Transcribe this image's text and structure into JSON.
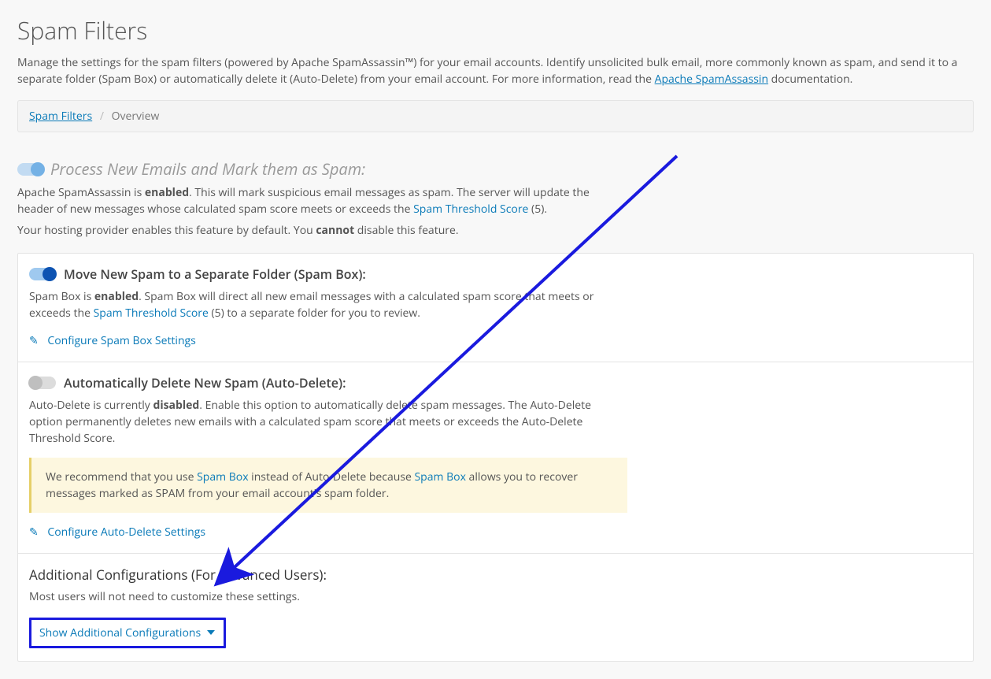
{
  "title": "Spam Filters",
  "intro_before_link": "Manage the settings for the spam filters (powered by Apache SpamAssassin™) for your email accounts. Identify unsolicited bulk email, more commonly known as spam, and send it to a separate folder (Spam Box) or automatically delete it (Auto-Delete) from your email account. For more information, read the ",
  "intro_link": "Apache SpamAssassin",
  "intro_after_link": " documentation.",
  "breadcrumb": {
    "root": "Spam Filters",
    "current": "Overview"
  },
  "process": {
    "heading": "Process New Emails and Mark them as Spam:",
    "desc_a": "Apache SpamAssassin is ",
    "desc_b_strong": "enabled",
    "desc_c": ". This will mark suspicious email messages as spam. The server will update the header of new messages whose calculated spam score meets or exceeds the ",
    "desc_link": "Spam Threshold Score",
    "desc_d": " (5).",
    "note_a": "Your hosting provider enables this feature by default. You ",
    "note_strong": "cannot",
    "note_b": " disable this feature."
  },
  "spambox": {
    "heading": "Move New Spam to a Separate Folder (Spam Box):",
    "desc_a": "Spam Box is ",
    "desc_strong": "enabled",
    "desc_b": ". Spam Box will direct all new email messages with a calculated spam score that meets or exceeds the ",
    "desc_link": "Spam Threshold Score",
    "desc_c": " (5) to a separate folder for you to review.",
    "configure": "Configure Spam Box Settings"
  },
  "autodelete": {
    "heading": "Automatically Delete New Spam (Auto-Delete):",
    "desc_a": "Auto-Delete is currently ",
    "desc_strong": "disabled",
    "desc_b": ". Enable this option to automatically delete spam messages. The Auto-Delete option permanently deletes new emails with a calculated spam score that meets or exceeds the Auto-Delete Threshold Score.",
    "alert_a": "We recommend that you use ",
    "alert_link1": "Spam Box",
    "alert_b": " instead of Auto-Delete because ",
    "alert_link2": "Spam Box",
    "alert_c": " allows you to recover messages marked as SPAM from your email account's spam folder.",
    "configure": "Configure Auto-Delete Settings"
  },
  "additional": {
    "heading": "Additional Configurations (For Advanced Users):",
    "subtext": "Most users will not need to customize these settings.",
    "toggle_label": "Show Additional Configurations"
  }
}
